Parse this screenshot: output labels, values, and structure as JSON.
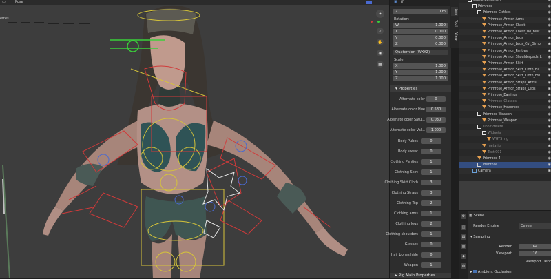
{
  "viewport": {
    "header_items": [
      "Pose"
    ],
    "left_label": "ettes"
  },
  "npanel": {
    "location_z": {
      "axis": "Z",
      "value": "0 m"
    },
    "rotation_label": "Rotation:",
    "rotation": [
      {
        "axis": "W",
        "value": "1.000"
      },
      {
        "axis": "X",
        "value": "0.000"
      },
      {
        "axis": "Y",
        "value": "0.000"
      },
      {
        "axis": "Z",
        "value": "0.000"
      }
    ],
    "rotation_mode": "Quaternion (WXYZ)",
    "scale_label": "Scale:",
    "scale": [
      {
        "axis": "X",
        "value": "1.000"
      },
      {
        "axis": "Y",
        "value": "1.000"
      },
      {
        "axis": "Z",
        "value": "1.000"
      }
    ],
    "properties_header": "Properties",
    "properties": [
      {
        "label": "Alternate color",
        "value": "0"
      },
      {
        "label": "Alternate color Hue",
        "value": "0.580"
      },
      {
        "label": "Alternate color Satu...",
        "value": "0.030"
      },
      {
        "label": "Alternate color Val...",
        "value": "1.000"
      },
      {
        "label": "Body Pubes",
        "value": "0"
      },
      {
        "label": "Body sweat",
        "value": "0"
      },
      {
        "label": "Clothing Panties",
        "value": "1"
      },
      {
        "label": "Clothing Skirt",
        "value": "1"
      },
      {
        "label": "Clothing Skirt Cloth",
        "value": "3"
      },
      {
        "label": "Clothing Straps",
        "value": "3"
      },
      {
        "label": "Clothing Top",
        "value": "2"
      },
      {
        "label": "Clothing arms",
        "value": "1"
      },
      {
        "label": "Clothing legs",
        "value": "2"
      },
      {
        "label": "Clothing shoulders",
        "value": "1"
      },
      {
        "label": "Glasses",
        "value": "0"
      },
      {
        "label": "Hair bones hide",
        "value": "0"
      },
      {
        "label": "Weapon",
        "value": "1"
      }
    ],
    "footer_header": "Rig Main Properties",
    "tabs": [
      "Item",
      "Tool",
      "View"
    ]
  },
  "outliner": {
    "items": [
      {
        "label": "Scene Collection",
        "indent": 0,
        "kind": "collection"
      },
      {
        "label": "Primrose",
        "indent": 1,
        "kind": "collection"
      },
      {
        "label": "Primrose Clothes",
        "indent": 2,
        "kind": "collection"
      },
      {
        "label": "Primrose_Armor_Arms",
        "indent": 3,
        "kind": "mesh"
      },
      {
        "label": "Primrose_Armor_Chest",
        "indent": 3,
        "kind": "mesh"
      },
      {
        "label": "Primrose_Armor_Chest_No_Blur",
        "indent": 3,
        "kind": "mesh"
      },
      {
        "label": "Primrose_Armor_Legs",
        "indent": 3,
        "kind": "mesh"
      },
      {
        "label": "Primrose_Armor_Legs_Cut_Simp",
        "indent": 3,
        "kind": "mesh"
      },
      {
        "label": "Primrose_Armor_Panties",
        "indent": 3,
        "kind": "mesh"
      },
      {
        "label": "Primrose_Armor_Shoulderpads_L",
        "indent": 3,
        "kind": "mesh"
      },
      {
        "label": "Primrose_Armor_Skirt",
        "indent": 3,
        "kind": "mesh"
      },
      {
        "label": "Primrose_Armor_Skirt_Cloth_Ba",
        "indent": 3,
        "kind": "mesh"
      },
      {
        "label": "Primrose_Armor_Skirt_Cloth_Fro",
        "indent": 3,
        "kind": "mesh"
      },
      {
        "label": "Primrose_Armor_Straps_Arms",
        "indent": 3,
        "kind": "mesh"
      },
      {
        "label": "Primrose_Armor_Straps_Legs",
        "indent": 3,
        "kind": "mesh"
      },
      {
        "label": "Primrose_Earrings",
        "indent": 3,
        "kind": "mesh"
      },
      {
        "label": "Primrose_Glasses",
        "indent": 3,
        "kind": "mesh-dim"
      },
      {
        "label": "Primrose_Headress",
        "indent": 3,
        "kind": "mesh"
      },
      {
        "label": "Primrose Weapon",
        "indent": 2,
        "kind": "collection"
      },
      {
        "label": "Primrose_Weapon",
        "indent": 3,
        "kind": "mesh"
      },
      {
        "label": "Don't delete",
        "indent": 2,
        "kind": "collection-dim"
      },
      {
        "label": "Widgets",
        "indent": 3,
        "kind": "collection-dim"
      },
      {
        "label": "WGTS_rig",
        "indent": 4,
        "kind": "mesh-dim"
      },
      {
        "label": "metarig",
        "indent": 3,
        "kind": "mesh-dim"
      },
      {
        "label": "Text.001",
        "indent": 3,
        "kind": "mesh-dim"
      },
      {
        "label": "Primrose 4",
        "indent": 2,
        "kind": "mesh"
      },
      {
        "label": "Primrose",
        "indent": 2,
        "kind": "armature-sel"
      },
      {
        "label": "Camera",
        "indent": 1,
        "kind": "camera"
      }
    ]
  },
  "properties_editor": {
    "scene_label": "Scene",
    "render_engine_label": "Render Engine",
    "render_engine_value": "Eevee",
    "sampling_label": "Sampling",
    "render_label": "Render",
    "render_value": "64",
    "viewport_label": "Viewport",
    "viewport_value": "16",
    "viewport_denoise_label": "Viewport Denoi",
    "ambient_occlusion_label": "Ambient Occlusion"
  },
  "colors": {
    "accent": "#4772b3",
    "bg": "#3d3d3d",
    "mesh_icon": "#e6a050",
    "collection_icon": "#e6e6e6",
    "bone_red": "#d03a3a",
    "bone_yellow": "#d6c43a"
  }
}
